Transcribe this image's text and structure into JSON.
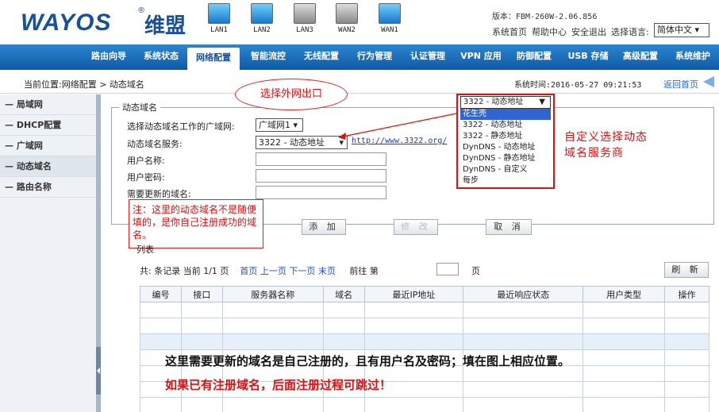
{
  "header": {
    "logo": "WAYOS",
    "logo_cn": "维盟",
    "reg_mark": "®",
    "ports": [
      {
        "label": "LAN1",
        "active": true
      },
      {
        "label": "LAN2",
        "active": true
      },
      {
        "label": "LAN3",
        "active": false
      },
      {
        "label": "WAN2",
        "active": false
      },
      {
        "label": "WAN1",
        "active": true
      }
    ],
    "version": "版本：FBM-260W-2.06.856",
    "links": [
      "系统首页",
      "帮助中心",
      "安全退出",
      "选择语言:"
    ],
    "language": "简体中文 ▾"
  },
  "nav": {
    "items": [
      "路由向导",
      "系统状态",
      "网络配置",
      "智能流控",
      "无线配置",
      "行为管理",
      "认证管理",
      "VPN 应用",
      "防御配置",
      "USB 存储",
      "高级配置",
      "系统维护"
    ],
    "active_index": 2
  },
  "breadcrumb": {
    "location": "当前位置:网络配置 > 动态域名",
    "system_time": "系统时间:2016-05-27 09:21:53",
    "back": "返回首页"
  },
  "sidebar": {
    "items": [
      "— 局域网",
      "— DHCP配置",
      "— 广域网",
      "— 动态域名",
      "— 路由名称"
    ],
    "active_index": 3
  },
  "form": {
    "legend": "动态域名",
    "labels": {
      "wan": "选择动态域名工作的广域网:",
      "service": "动态域名服务:",
      "user": "用户名称:",
      "password": "用户密码:",
      "domain": "需要更新的域名:"
    },
    "wan_value": "广域网1 ▾",
    "service_value": "3322 - 动态地址",
    "service_link": "http://www.3322.org/",
    "buttons": {
      "add": "添 加",
      "modify": "修 改",
      "cancel": "取 消"
    }
  },
  "dropdown": {
    "selected": "3322 - 动态地址",
    "options": [
      "花生壳",
      "3322 - 动态地址",
      "3322 - 静态地址",
      "DynDNS - 动态地址",
      "DynDNS - 静态地址",
      "DynDNS - 自定义",
      "每步"
    ],
    "highlight_index": 0
  },
  "annotations": {
    "bubble": "选择外网出口",
    "right_note": "自定义选择动态域名服务商",
    "note": "注：这里的动态域名不是随便填的，是你自己注册成功的域名。",
    "bottom1": "这里需要更新的域名是自己注册的，且有用户名及密码；填在图上相应位置。",
    "bottom2": "如果已有注册域名，后面注册过程可跳过！"
  },
  "list": {
    "legend": "列表",
    "pager_prefix": "共:  条记录 当前  1/1  页",
    "first": "首页",
    "prev": "上一页",
    "next": "下一页",
    "last": "末页",
    "goto_prefix": "前往 第",
    "goto_suffix": "页",
    "refresh": "刷 新",
    "columns": [
      "编号",
      "接口",
      "服务器名称",
      "域名",
      "最近IP地址",
      "最近响应状态",
      "用户类型",
      "操作"
    ]
  }
}
